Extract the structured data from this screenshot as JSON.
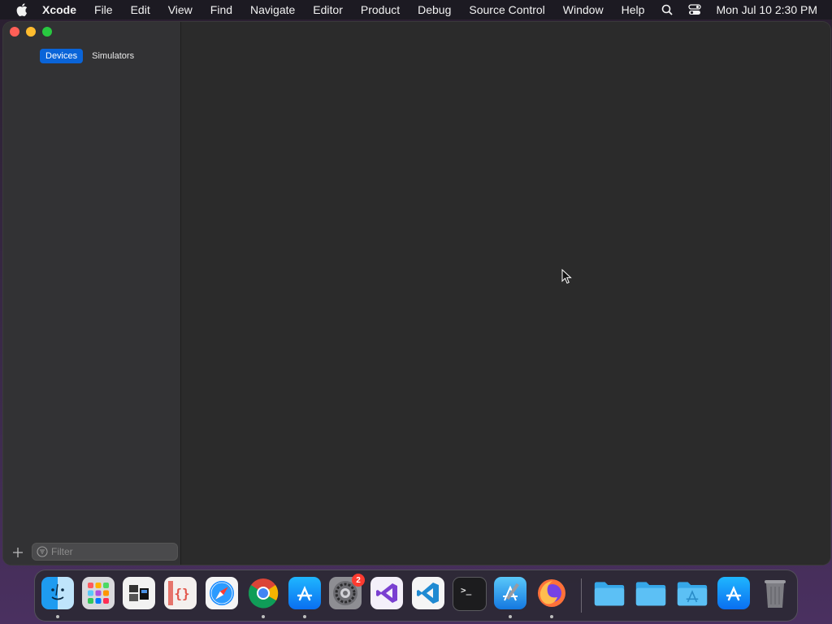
{
  "menubar": {
    "app_name": "Xcode",
    "items": [
      "File",
      "Edit",
      "View",
      "Find",
      "Navigate",
      "Editor",
      "Product",
      "Debug",
      "Source Control",
      "Window",
      "Help"
    ],
    "clock": "Mon Jul 10  2:30 PM"
  },
  "sidebar": {
    "tabs": [
      {
        "label": "Devices",
        "active": true
      },
      {
        "label": "Simulators",
        "active": false
      }
    ],
    "filter_placeholder": "Filter"
  },
  "dock": {
    "apps": [
      {
        "name": "finder-icon",
        "running": true
      },
      {
        "name": "launchpad-icon",
        "running": false
      },
      {
        "name": "window-manager-icon",
        "running": false
      },
      {
        "name": "json-editor-icon",
        "running": false
      },
      {
        "name": "safari-icon",
        "running": false
      },
      {
        "name": "chrome-icon",
        "running": true
      },
      {
        "name": "app-store-icon",
        "running": true
      },
      {
        "name": "system-settings-icon",
        "running": false,
        "badge": "2"
      },
      {
        "name": "visual-studio-icon",
        "running": false
      },
      {
        "name": "vscode-icon",
        "running": false
      },
      {
        "name": "terminal-icon",
        "running": false
      },
      {
        "name": "xcode-icon",
        "running": true
      },
      {
        "name": "firefox-icon",
        "running": true
      },
      {
        "name": "folder-icon",
        "running": false
      },
      {
        "name": "folder-icon",
        "running": false
      },
      {
        "name": "applications-folder-icon",
        "running": false
      },
      {
        "name": "app-store-icon",
        "running": false
      },
      {
        "name": "trash-icon",
        "running": false
      }
    ]
  },
  "colors": {
    "accent": "#0a64d8",
    "close": "#fe5f57",
    "minimize": "#febc2e",
    "maximize": "#28c840"
  }
}
